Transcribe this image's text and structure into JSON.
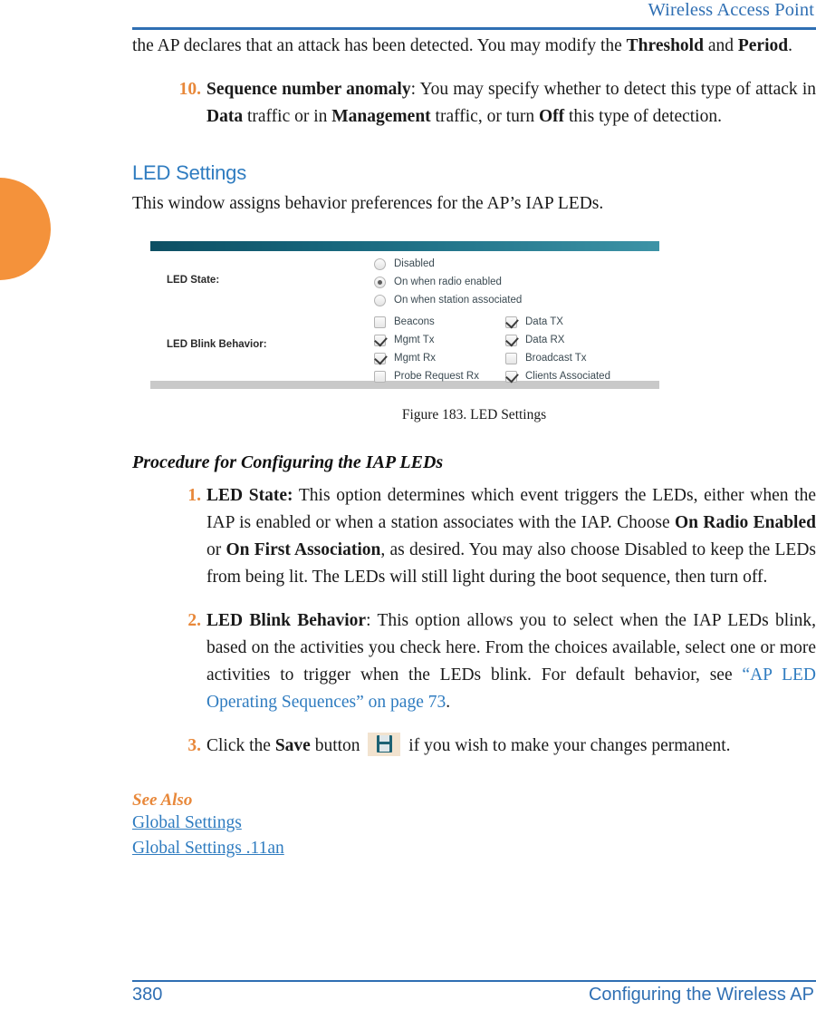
{
  "header": {
    "title": "Wireless Access Point"
  },
  "edge_tab": {
    "color": "#f4923b"
  },
  "intro_paragraph": {
    "line1_pre": "the AP declares that an attack has been detected. You may modify the ",
    "bold1": "Threshold",
    "mid": " and ",
    "bold2": "Period",
    "end": "."
  },
  "list_item_10": {
    "number": "10.",
    "bold_lead": "Sequence number anomaly",
    "text_a": ": You may specify whether to detect this type of attack in ",
    "bold_a": "Data",
    "text_b": " traffic or in ",
    "bold_b": "Management",
    "text_c": " traffic, or turn ",
    "bold_c": "Off",
    "text_d": " this type of detection."
  },
  "section": {
    "heading": "LED Settings",
    "intro": "This window assigns behavior preferences for the AP’s IAP LEDs."
  },
  "figure": {
    "caption": "Figure 183. LED Settings",
    "led_state_label": "LED State:",
    "led_blink_label": "LED Blink Behavior:",
    "radio_options": [
      {
        "label": "Disabled",
        "selected": false
      },
      {
        "label": "On when radio enabled",
        "selected": true
      },
      {
        "label": "On when station associated",
        "selected": false
      }
    ],
    "checkbox_rows": [
      [
        {
          "label": "Beacons",
          "checked": false
        },
        {
          "label": "Data TX",
          "checked": true
        }
      ],
      [
        {
          "label": "Mgmt Tx",
          "checked": true
        },
        {
          "label": "Data RX",
          "checked": true
        }
      ],
      [
        {
          "label": "Mgmt Rx",
          "checked": true
        },
        {
          "label": "Broadcast Tx",
          "checked": false
        }
      ],
      [
        {
          "label": "Probe Request Rx",
          "checked": false
        },
        {
          "label": "Clients Associated",
          "checked": true
        }
      ]
    ],
    "topbar_color": "#0d4f63",
    "bottombar_color": "#c9c9c9"
  },
  "procedure": {
    "heading": "Procedure for Configuring the IAP LEDs",
    "item1": {
      "number": "1.",
      "bold_lead": "LED State:",
      "text_a": " This option determines which event triggers the LEDs, either when the IAP is enabled or when a station associates with the IAP. Choose ",
      "bold_a": "On Radio Enabled",
      "text_b": " or ",
      "bold_b": "On First Association",
      "text_c": ", as desired. You may also choose Disabled to keep the LEDs from being lit. The LEDs will still light during the boot sequence, then turn off."
    },
    "item2": {
      "number": "2.",
      "bold_lead": "LED Blink Behavior",
      "text_a": ": This option allows you to select when the IAP LEDs blink, based on the activities you check here. From the choices available, select one or more activities to trigger when the LEDs blink. For default behavior, see ",
      "link": "“AP LED Operating Sequences” on page 73",
      "text_b": "."
    },
    "item3": {
      "number": "3.",
      "text_a": "Click the ",
      "bold_a": "Save",
      "text_b": " button ",
      "icon": "save-icon",
      "text_c": " if you wish to make your changes permanent."
    }
  },
  "see_also": {
    "heading": "See Also",
    "links": [
      "Global Settings",
      "Global Settings .11an"
    ]
  },
  "footer": {
    "page_number": "380",
    "title": "Configuring the Wireless AP"
  },
  "colors": {
    "header_blue": "#2f6fb3",
    "link_blue": "#2f7cc0",
    "accent_orange": "#e8883a",
    "tab_orange": "#f4923b"
  }
}
